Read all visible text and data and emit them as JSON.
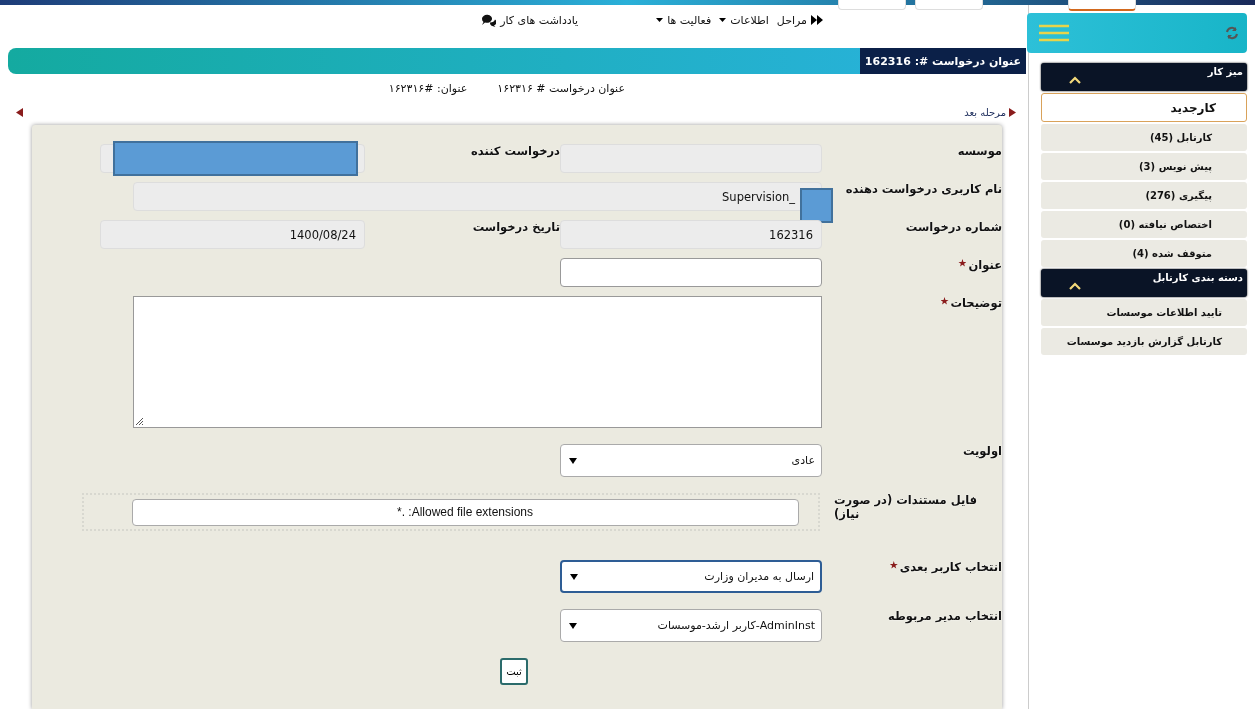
{
  "top_nav": [
    {
      "label": "مراحل",
      "kind": "steps"
    },
    {
      "label": "اطلاعات",
      "kind": "menu"
    },
    {
      "label": "فعالیت ها",
      "kind": "menu"
    },
    {
      "label": "یادداشت های کار",
      "kind": "notes"
    }
  ],
  "header": {
    "title": "عنوان درخواست #: 162316"
  },
  "subtitle": [
    "عنوان درخواست # ۱۶۲۳۱۶",
    "عنوان: #۱۶۲۳۱۶"
  ],
  "next_step": "مرحله بعد",
  "form": {
    "rows": [
      {
        "fields": [
          {
            "label": "موسسه",
            "kind": "readonly",
            "required": false
          },
          {
            "label": "درخواست کننده",
            "kind": "readonly",
            "required": false,
            "redacted": true
          }
        ]
      },
      {
        "fields": [
          {
            "label": "نام کاربری درخواست دهنده",
            "kind": "readonly_wide",
            "value": "Supervision_",
            "required": false,
            "redacted": true
          }
        ]
      },
      {
        "fields": [
          {
            "label": "شماره درخواست",
            "kind": "readonly",
            "value": "162316",
            "required": false
          },
          {
            "label": "تاریخ درخواست",
            "kind": "readonly",
            "value": "1400/08/24",
            "required": false
          }
        ]
      },
      {
        "fields": [
          {
            "label": "عنوان",
            "kind": "text",
            "required": true
          }
        ]
      },
      {
        "fields": [
          {
            "label": "توضیحات",
            "kind": "textarea",
            "required": true
          }
        ]
      },
      {
        "fields": [
          {
            "label": "اولویت",
            "kind": "select",
            "value": "عادی",
            "required": false,
            "focused": false
          }
        ]
      },
      {
        "fields": [
          {
            "label": "فایل مستندات (در صورت نیاز)",
            "kind": "file",
            "value": "Allowed file extensions: .*",
            "required": false
          }
        ]
      },
      {
        "fields": [
          {
            "label": "انتخاب کاربر بعدی",
            "kind": "select",
            "value": "ارسال به مدیران وزارت",
            "required": true,
            "focused": true
          }
        ]
      },
      {
        "fields": [
          {
            "label": "انتخاب مدیر مربوطه",
            "kind": "select",
            "value": "AdminInst-کاربر ارشد-موسسات",
            "required": false,
            "focused": false
          }
        ]
      }
    ],
    "submit": "ثبت"
  },
  "sidebar": {
    "sections": [
      {
        "title": "میز کار",
        "expanded": true,
        "items": [
          {
            "label": "کارجدید",
            "selected": true
          },
          {
            "label": "کارتابل (45)",
            "selected": false
          },
          {
            "label": "پیش نویس (3)",
            "selected": false
          },
          {
            "label": "پیگیری (276)",
            "selected": false
          },
          {
            "label": "اختصاص نیافته (0)",
            "selected": false
          },
          {
            "label": "متوقف شده (4)",
            "selected": false
          }
        ]
      },
      {
        "title": "دسته بندی کارتابل",
        "expanded": true,
        "items": [
          {
            "label": "تایید اطلاعات موسسات",
            "selected": false
          },
          {
            "label": "کارتابل گزارش بازدید موسسات",
            "selected": false
          }
        ]
      }
    ]
  }
}
